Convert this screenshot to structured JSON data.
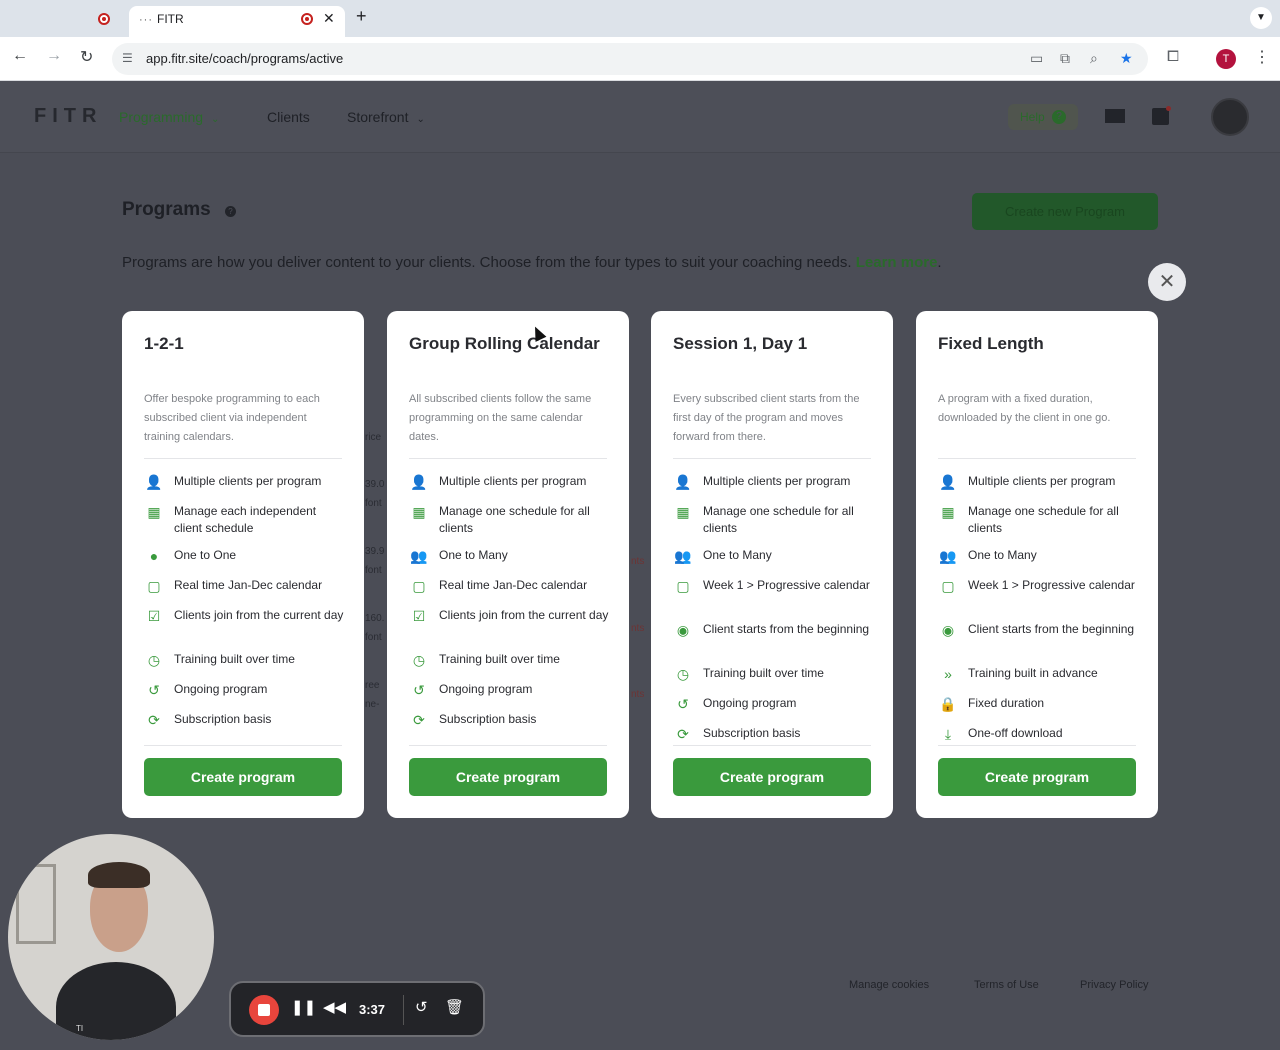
{
  "browser": {
    "tab_title": "FITR",
    "tab_favicon": "···",
    "url": "app.fitr.site/coach/programs/active",
    "profile_initial": "T"
  },
  "header": {
    "logo": "FITR",
    "nav": {
      "programming": "Programming",
      "clients": "Clients",
      "storefront": "Storefront"
    },
    "help_label": "Help",
    "help_icon": "?"
  },
  "page": {
    "title": "Programs",
    "create_button": "Create new Program",
    "intro": "Programs are how you deliver content to your clients. Choose from the four types to suit your coaching needs.",
    "learn_more": "Learn more",
    "period": "."
  },
  "background_fragments": {
    "f1": "rice",
    "f2": "39.0",
    "f3": "font",
    "f4": "39.9",
    "f5": "font",
    "f6": "160.",
    "f7": "font",
    "f8": "ree",
    "f9": "ne-",
    "f10": "nts",
    "f11": "nts",
    "f12": "nts"
  },
  "cards": [
    {
      "title": "1-2-1",
      "description": "Offer bespoke programming to each subscribed client via independent training calendars.",
      "features": [
        {
          "icon": "user-plus-icon",
          "text": "Multiple clients per program"
        },
        {
          "icon": "calendar-grid-icon",
          "text": "Manage each independent client schedule"
        },
        {
          "icon": "user-icon",
          "text": "One to One"
        },
        {
          "icon": "calendar-icon",
          "text": "Real time Jan-Dec calendar"
        },
        {
          "icon": "calendar-check-icon",
          "text": "Clients join from the current day"
        },
        {
          "icon": "clock-icon",
          "text": "Training built over time"
        },
        {
          "icon": "history-icon",
          "text": "Ongoing program"
        },
        {
          "icon": "refresh-icon",
          "text": "Subscription basis"
        }
      ],
      "button": "Create program"
    },
    {
      "title": "Group Rolling Calendar",
      "description": "All subscribed clients follow the same programming on the same calendar dates.",
      "features": [
        {
          "icon": "user-plus-icon",
          "text": "Multiple clients per program"
        },
        {
          "icon": "calendar-grid-icon",
          "text": "Manage one schedule for all clients"
        },
        {
          "icon": "users-icon",
          "text": "One to Many"
        },
        {
          "icon": "calendar-icon",
          "text": "Real time Jan-Dec calendar"
        },
        {
          "icon": "calendar-check-icon",
          "text": "Clients join from the current day"
        },
        {
          "icon": "clock-icon",
          "text": "Training built over time"
        },
        {
          "icon": "history-icon",
          "text": "Ongoing program"
        },
        {
          "icon": "refresh-icon",
          "text": "Subscription basis"
        }
      ],
      "button": "Create program"
    },
    {
      "title": "Session 1, Day 1",
      "description": "Every subscribed client starts from the first day of the program and moves forward from there.",
      "features": [
        {
          "icon": "user-plus-icon",
          "text": "Multiple clients per program"
        },
        {
          "icon": "calendar-grid-icon",
          "text": "Manage one schedule for all clients"
        },
        {
          "icon": "users-icon",
          "text": "One to Many"
        },
        {
          "icon": "calendar-icon",
          "text": "Week 1 > Progressive calendar"
        },
        {
          "icon": "play-circle-icon",
          "text": "Client starts from the beginning"
        },
        {
          "icon": "clock-icon",
          "text": "Training built over time"
        },
        {
          "icon": "history-icon",
          "text": "Ongoing program"
        },
        {
          "icon": "refresh-icon",
          "text": "Subscription basis"
        }
      ],
      "button": "Create program"
    },
    {
      "title": "Fixed Length",
      "description": "A program with a fixed duration, downloaded by the client in one go.",
      "features": [
        {
          "icon": "user-plus-icon",
          "text": "Multiple clients per program"
        },
        {
          "icon": "calendar-grid-icon",
          "text": "Manage one schedule for all clients"
        },
        {
          "icon": "users-icon",
          "text": "One to Many"
        },
        {
          "icon": "calendar-icon",
          "text": "Week 1 > Progressive calendar"
        },
        {
          "icon": "play-circle-icon",
          "text": "Client starts from the beginning"
        },
        {
          "icon": "fast-forward-icon",
          "text": "Training built in advance"
        },
        {
          "icon": "lock-icon",
          "text": "Fixed duration"
        },
        {
          "icon": "download-icon",
          "text": "One-off download"
        }
      ],
      "button": "Create program"
    }
  ],
  "footer": {
    "manage_cookies": "Manage cookies",
    "terms": "Terms of Use",
    "privacy": "Privacy Policy"
  },
  "recorder": {
    "time": "3:37",
    "shirt_text": "TI"
  },
  "colors": {
    "accent_green": "#3a9a3d",
    "overlay": "#4b4d56",
    "card_bg": "#ffffff"
  }
}
